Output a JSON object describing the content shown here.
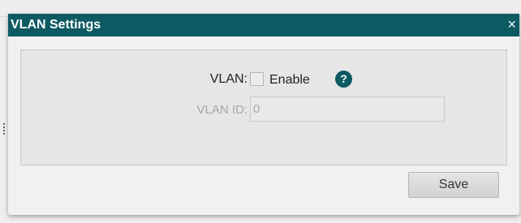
{
  "dialog": {
    "title": "VLAN Settings",
    "close_label": "×",
    "colors": {
      "titlebar": "#0d5a63",
      "help_icon": "#0d5a63"
    }
  },
  "form": {
    "vlan_label": "VLAN:",
    "enable_label": "Enable",
    "enable_checked": false,
    "help_icon": "question-icon",
    "help_glyph": "?",
    "vlan_id_label": "VLAN ID:",
    "vlan_id_value": "0"
  },
  "actions": {
    "save_label": "Save"
  }
}
